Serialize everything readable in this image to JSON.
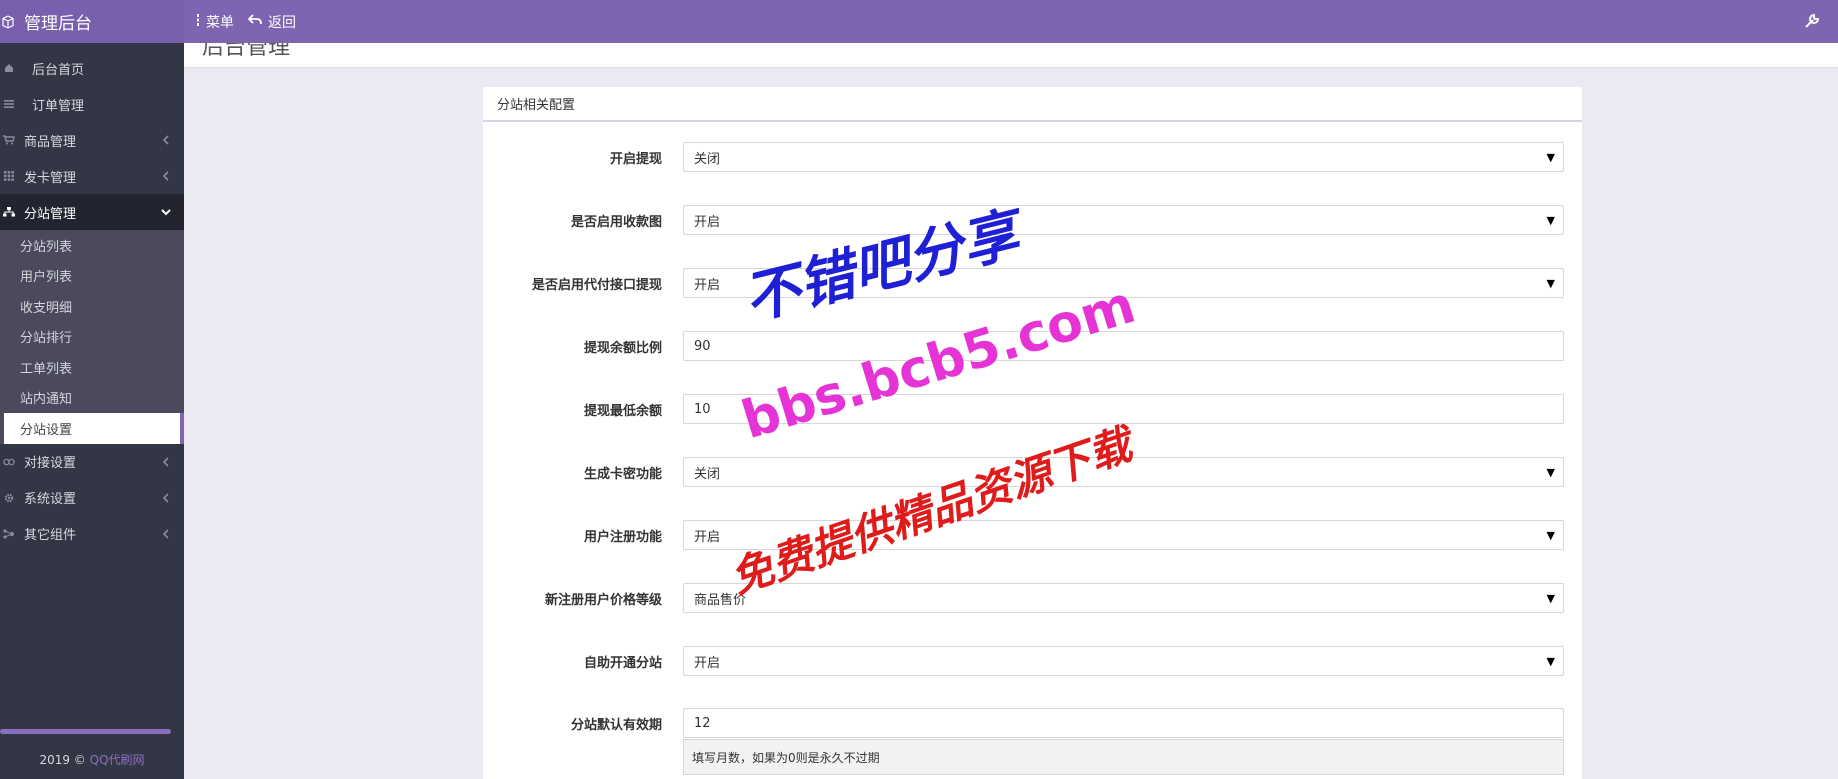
{
  "header": {
    "brand": "管理后台",
    "menu_label": "菜单",
    "back_label": "返回"
  },
  "sidebar": {
    "items": [
      {
        "label": "后台首页",
        "icon": "home-icon"
      },
      {
        "label": "订单管理",
        "icon": "list-icon"
      },
      {
        "label": "商品管理",
        "icon": "cart-icon"
      },
      {
        "label": "发卡管理",
        "icon": "grid-icon"
      },
      {
        "label": "分站管理",
        "icon": "sitemap-icon"
      },
      {
        "label": "对接设置",
        "icon": "link-icon"
      },
      {
        "label": "系统设置",
        "icon": "gear-icon"
      },
      {
        "label": "其它组件",
        "icon": "puzzle-icon"
      }
    ],
    "sub_items": [
      "分站列表",
      "用户列表",
      "收支明细",
      "分站排行",
      "工单列表",
      "站内通知",
      "分站设置"
    ],
    "footer_year": "2019 ©",
    "footer_link": "QQ代刷网"
  },
  "page": {
    "title": "后台管理"
  },
  "panel": {
    "title": "分站相关配置",
    "fields": [
      {
        "label": "开启提现",
        "value": "关闭",
        "type": "select"
      },
      {
        "label": "是否启用收款图",
        "value": "开启",
        "type": "select"
      },
      {
        "label": "是否启用代付接口提现",
        "value": "开启",
        "type": "select"
      },
      {
        "label": "提现余额比例",
        "value": "90",
        "type": "input"
      },
      {
        "label": "提现最低余额",
        "value": "10",
        "type": "input"
      },
      {
        "label": "生成卡密功能",
        "value": "关闭",
        "type": "select"
      },
      {
        "label": "用户注册功能",
        "value": "开启",
        "type": "select"
      },
      {
        "label": "新注册用户价格等级",
        "value": "商品售价",
        "type": "select"
      },
      {
        "label": "自助开通分站",
        "value": "开启",
        "type": "select"
      },
      {
        "label": "分站默认有效期",
        "value": "12",
        "type": "input"
      }
    ],
    "help_text": "填写月数，如果为0则是永久不过期"
  },
  "watermark": {
    "line1": "不错吧分享",
    "line2": "bbs.bcb5.com",
    "line3": "免费提供精品资源下载"
  },
  "colors": {
    "header": "#7e64b1",
    "sidebar": "#333645",
    "accent": "#8a6fc1"
  }
}
